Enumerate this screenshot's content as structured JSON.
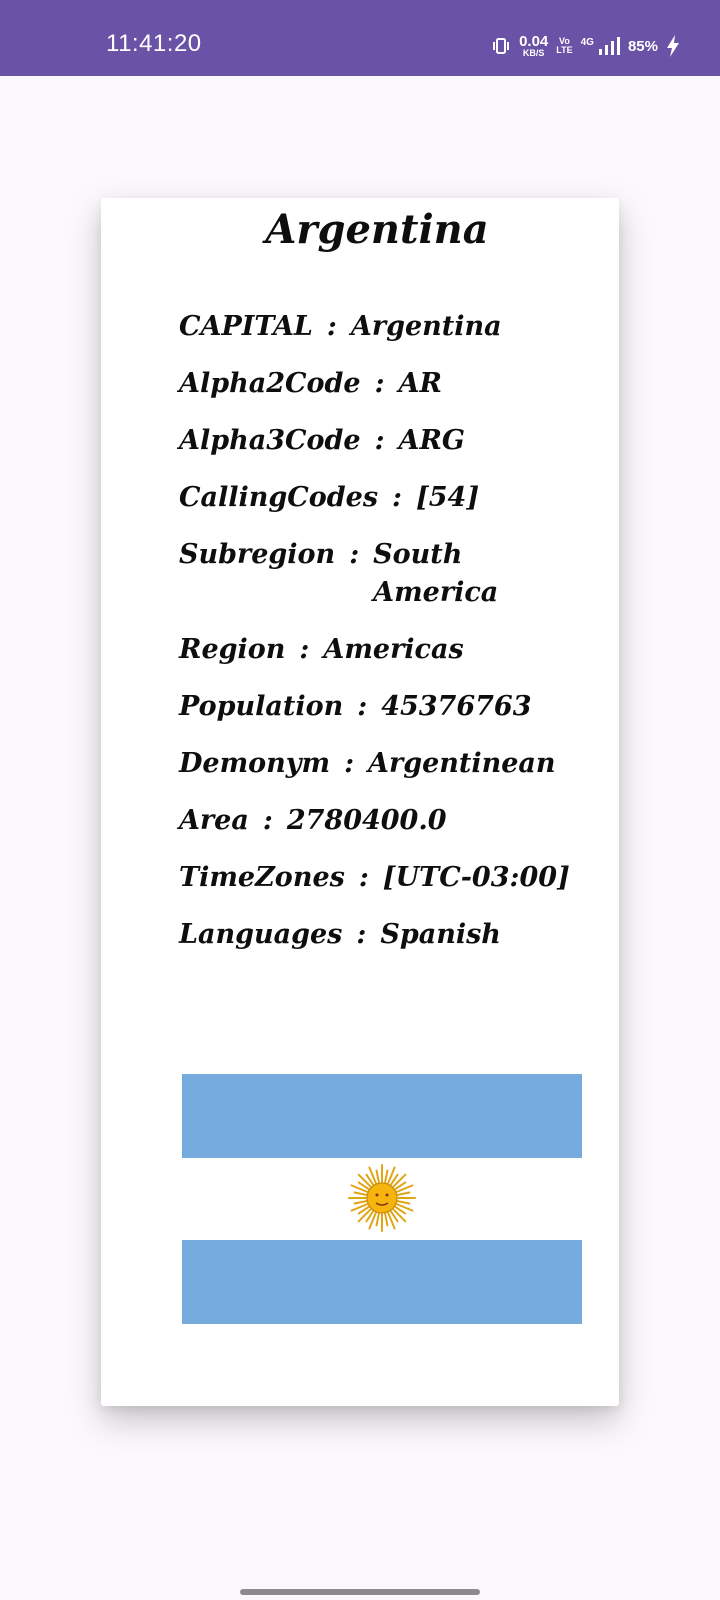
{
  "status_bar": {
    "time": "11:41:20",
    "net_speed_value": "0.04",
    "net_speed_unit": "KB/S",
    "volte_top": "Vo",
    "volte_bottom": "LTE",
    "network_gen": "4G",
    "battery": "85%",
    "background_color": "#6A52A6",
    "icons": [
      "vibrate-icon",
      "signal-icon",
      "charging-bolt-icon"
    ]
  },
  "country": {
    "name": "Argentina",
    "fields": [
      {
        "label": "CAPITAL",
        "sep": ":",
        "value": "Argentina"
      },
      {
        "label": "Alpha2Code",
        "sep": ":",
        "value": "AR"
      },
      {
        "label": "Alpha3Code",
        "sep": ":",
        "value": "ARG"
      },
      {
        "label": "CallingCodes",
        "sep": ":",
        "value": "[54]"
      },
      {
        "label": "Subregion",
        "sep": ":",
        "value": "South America"
      },
      {
        "label": "Region",
        "sep": ":",
        "value": "Americas"
      },
      {
        "label": "Population",
        "sep": ":",
        "value": "45376763"
      },
      {
        "label": "Demonym",
        "sep": ":",
        "value": "Argentinean"
      },
      {
        "label": "Area",
        "sep": ":",
        "value": "2780400.0"
      },
      {
        "label": "TimeZones",
        "sep": ":",
        "value": "[UTC-03:00]"
      },
      {
        "label": "Languages",
        "sep": ":",
        "value": "Spanish"
      }
    ],
    "flag": {
      "stripe_color": "#75ABDD",
      "center_color": "#FFFFFF",
      "sun_color": "#F6B40E",
      "emblem": "sun-of-may-icon"
    }
  }
}
